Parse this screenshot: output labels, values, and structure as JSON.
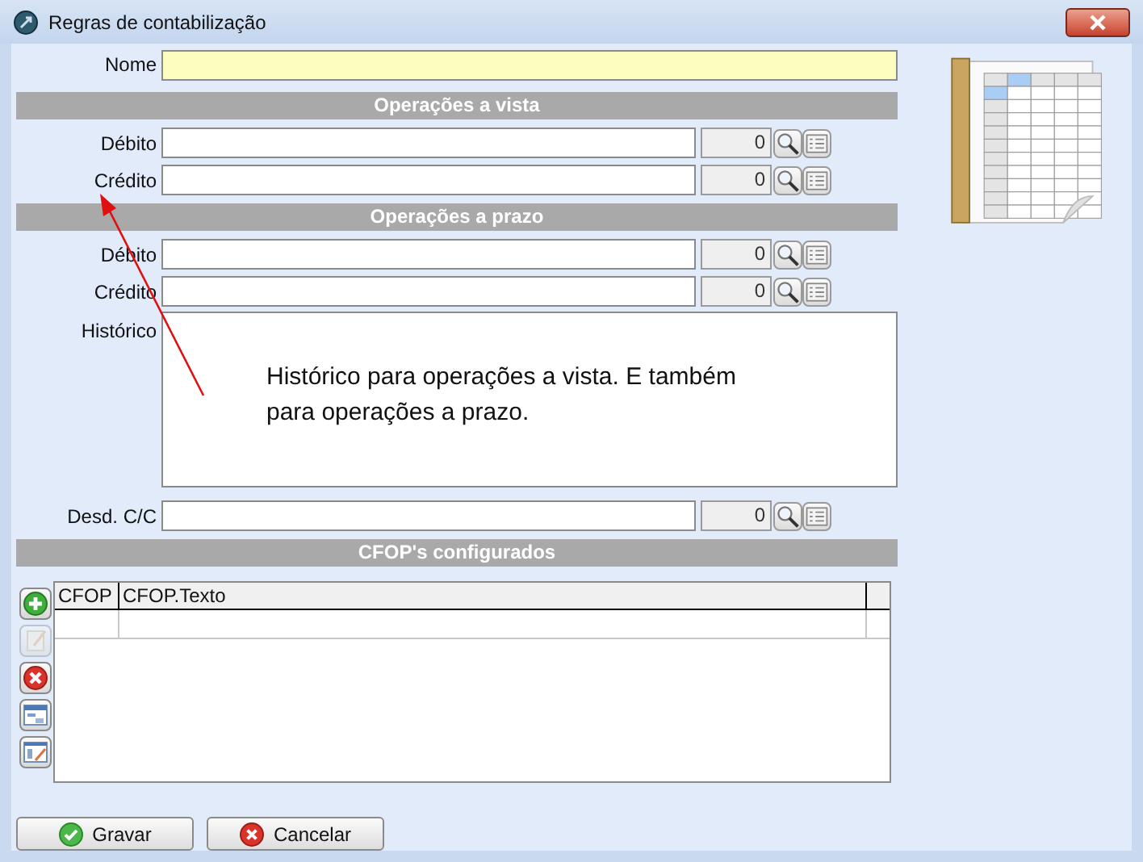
{
  "window": {
    "title": "Regras de contabilização"
  },
  "name_field": {
    "label": "Nome"
  },
  "section_vista": {
    "title": "Operações a vista",
    "accounts": [
      {
        "label": "Débito",
        "code": "0"
      },
      {
        "label": "Crédito",
        "code": "0"
      }
    ]
  },
  "section_prazo": {
    "title": "Operações a prazo",
    "accounts": [
      {
        "label": "Débito",
        "code": "0"
      },
      {
        "label": "Crédito",
        "code": "0"
      }
    ]
  },
  "historico": {
    "label": "Histórico"
  },
  "desdobramento": {
    "label": "Desd. C/C",
    "code": "0"
  },
  "cfop": {
    "title": "CFOP's configurados",
    "columns": [
      "CFOP",
      "CFOP.Texto"
    ],
    "tools": [
      {
        "kind": "add",
        "disabled": false
      },
      {
        "kind": "edit",
        "disabled": true
      },
      {
        "kind": "delete",
        "disabled": false
      },
      {
        "kind": "columns",
        "disabled": false
      },
      {
        "kind": "form",
        "disabled": false
      }
    ]
  },
  "annotation": {
    "text": "Histórico para operações a vista. E também para operações a prazo."
  },
  "buttons": [
    {
      "label": "Gravar",
      "kind": "confirm"
    },
    {
      "label": "Cancelar",
      "kind": "cancel"
    }
  ]
}
